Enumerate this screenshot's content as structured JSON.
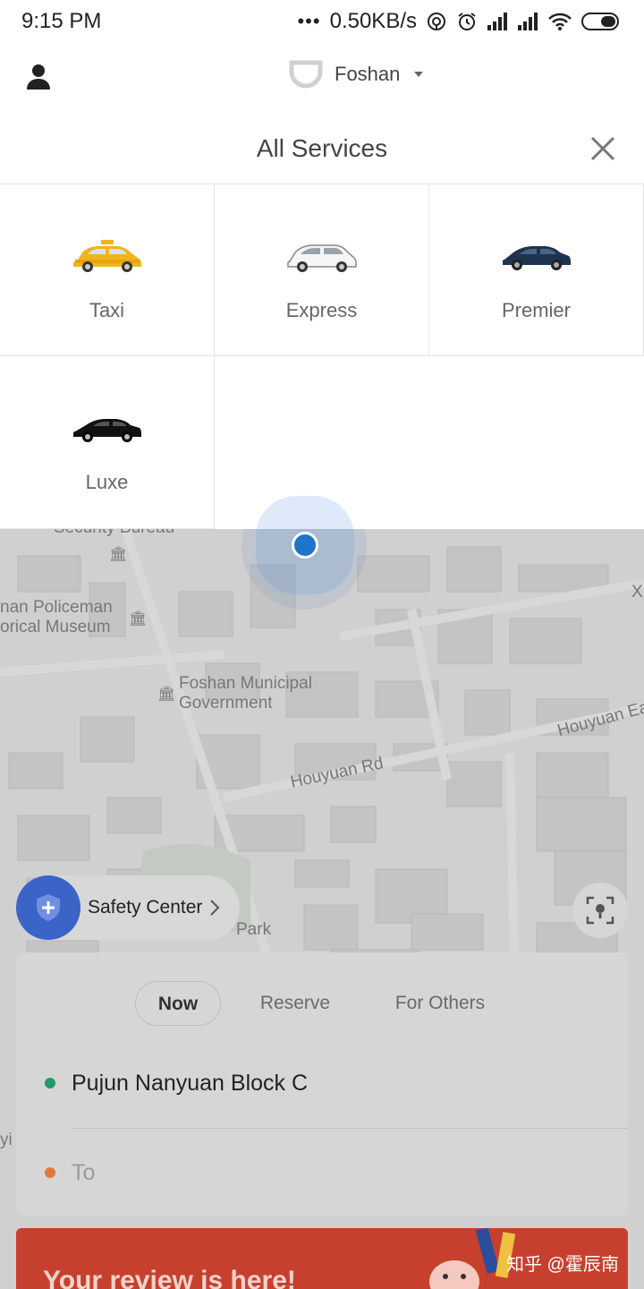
{
  "status_bar": {
    "time": "9:15 PM",
    "network_speed": "0.50KB/s",
    "icons": [
      "dots-icon",
      "hotspot-icon",
      "alarm-icon",
      "signal-icon",
      "signal-icon-2",
      "wifi-icon",
      "battery-icon"
    ]
  },
  "header": {
    "city": "Foshan",
    "icons": [
      "user-icon",
      "brand-logo-icon",
      "chevron-down-icon"
    ]
  },
  "services": {
    "title": "All Services",
    "close_icon": "close-icon",
    "items": [
      {
        "label": "Taxi",
        "icon": "taxi-car-icon",
        "color": "#f2b41b"
      },
      {
        "label": "Express",
        "icon": "express-car-icon",
        "color": "#f5f5f5"
      },
      {
        "label": "Premier",
        "icon": "premier-car-icon",
        "color": "#1e3350"
      },
      {
        "label": "Luxe",
        "icon": "luxe-car-icon",
        "color": "#111111"
      }
    ]
  },
  "map": {
    "labels": {
      "bureau": "Security Bureau",
      "museum_line1": "nan Policeman",
      "museum_line2": "orical Museum",
      "gov_line1": "Foshan Municipal",
      "gov_line2": "Government",
      "road1": "Houyuan Rd",
      "road2": "Houyuan Ea",
      "park": "Park",
      "edge_x": "X",
      "edge_yi": "yi"
    }
  },
  "safety_center": {
    "label": "Safety Center"
  },
  "booking": {
    "tabs": [
      {
        "label": "Now",
        "active": true
      },
      {
        "label": "Reserve",
        "active": false
      },
      {
        "label": "For Others",
        "active": false
      }
    ],
    "pickup": "Pujun Nanyuan Block C",
    "destination_placeholder": "To",
    "pickup_color": "#1f9a68",
    "destination_color": "#e07a3c"
  },
  "banner": {
    "text": "Your review is here!"
  },
  "watermark": "知乎 @霍辰南"
}
